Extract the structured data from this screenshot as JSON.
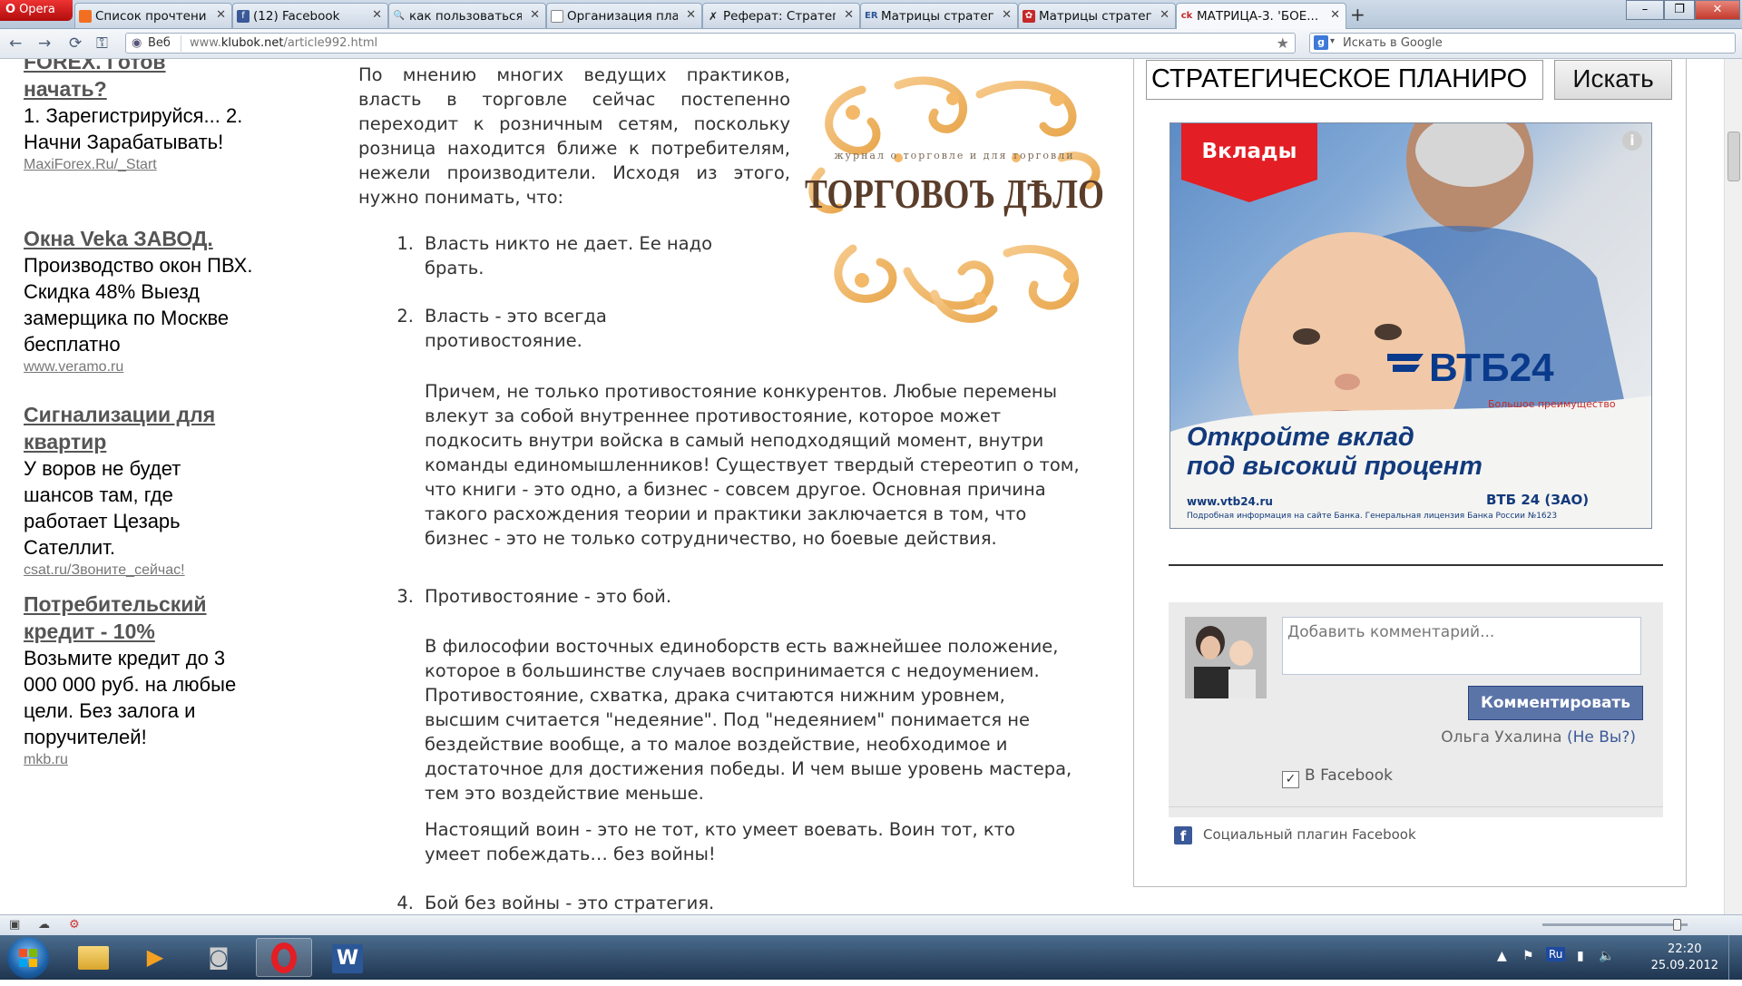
{
  "browser": {
    "menu_label": "Opera",
    "tabs": [
      {
        "label": "Список прочтени...",
        "favicon_color": "#f26f21"
      },
      {
        "label": "(12) Facebook",
        "favicon_color": "#3b5998"
      },
      {
        "label": "как пользоваться...",
        "favicon_color": "#444444"
      },
      {
        "label": "Организация пла...",
        "favicon_color": "#888888"
      },
      {
        "label": "Реферат: Стратег...",
        "favicon_color": "#222222"
      },
      {
        "label": "Матрицы стратег...",
        "favicon_color": "#2b5797"
      },
      {
        "label": "Матрицы стратег...",
        "favicon_color": "#c62828"
      },
      {
        "label": "МАТРИЦА-3. 'БОЕ...",
        "favicon_color": "#c62828"
      }
    ],
    "active_tab_index": 7,
    "address": {
      "mode_label": "Веб",
      "url_prefix": "www.",
      "url_domain": "klubok.net",
      "url_path": "/article992.html"
    },
    "search_placeholder": "Искать в Google"
  },
  "ads": [
    {
      "title": "FOREX. Готов начать?",
      "text": "1. Зарегистрируйся... 2. Начни Зарабатывать!",
      "link": "MaxiForex.Ru/_Start"
    },
    {
      "title": "Окна Veka ЗАВОД.",
      "text": "Производство окон ПВХ. Скидка 48% Выезд замерщика по Москве бесплатно",
      "link": "www.veramo.ru"
    },
    {
      "title": "Сигнализации для квартир",
      "text": "У воров не будет шансов там, где работает Цезарь Сателлит.",
      "link": "csat.ru/Звоните_сейчас!"
    },
    {
      "title": "Потребительский кредит - 10%",
      "text": "Возьмите кредит до 3 000 000 руб. на любые цели. Без залога и поручителей!",
      "link": "mkb.ru"
    }
  ],
  "article": {
    "intro": "По мнению многих ведущих практиков, власть в торговле сейчас постепенно переходит к розничным сетям, поскольку розница находится ближе к потребителям, нежели производители. Исходя из этого, нужно понимать, что:",
    "items": [
      {
        "num": "1.",
        "text": "Власть никто не дает. Ее надо брать."
      },
      {
        "num": "2.",
        "text": "Власть - это всегда противостояние."
      },
      {
        "num": "3.",
        "text": "Противостояние - это бой."
      },
      {
        "num": "4.",
        "text": "Бой без войны - это стратегия."
      }
    ],
    "para_2": [
      "Причем, не только противостояние конкурентов. Любые перемены",
      "влекут за собой внутреннее противостояние, которое может",
      "подкосить внутри войска в самый неподходящий момент, внутри",
      "команды единомышленников! Существует твердый стереотип о том,",
      "что книги - это одно, а бизнес - совсем другое. Основная причина",
      "такого расхождения теории и практики заключается в том, что",
      "бизнес - это не только сотрудничество, но боевые действия."
    ],
    "para_3a": [
      "В философии восточных единоборств есть важнейшее положение,",
      "которое в большинстве случаев воспринимается с недоумением.",
      "Противостояние, схватка, драка считаются нижним уровнем,",
      "высшим считается \"недеяние\". Под \"недеянием\" понимается не",
      "бездействие вообще, а то малое воздействие, необходимое и",
      "достаточное для достижения победы. И чем выше уровень мастера,",
      "тем это воздействие меньше."
    ],
    "para_3b": [
      "Настоящий воин - это не тот, кто умеет воевать. Воин тот, кто",
      "умеет побеждать… без войны!"
    ],
    "logo": {
      "tagline": "журнал о торговле и для торговли",
      "name": "ТОРГОВОЪ ДѢЛО"
    }
  },
  "sidebar": {
    "search_value": "СТРАТЕГИЧЕСКОЕ ПЛАНИРО",
    "search_button": "Искать",
    "banner": {
      "badge": "Вклады",
      "brand": "ВТБ24",
      "brand_sub": "Большое преимущество",
      "headline_1": "Откройте вклад",
      "headline_2": "под высокий процент",
      "site": "www.vtb24.ru",
      "entity": "ВТБ 24 (ЗАО)",
      "fineprint": "Подробная информация на сайте Банка. Генеральная лицензия Банка России №1623",
      "badge_color": "#e31e24",
      "brand_color": "#0a3a8c"
    },
    "comments": {
      "placeholder": "Добавить комментарий...",
      "submit": "Комментировать",
      "user": "Ольга Ухалина",
      "not_you": "(Не Вы?)",
      "post_to": "В Facebook",
      "post_to_checked": true,
      "plugin_label": "Социальный плагин Facebook"
    }
  },
  "taskbar": {
    "lang": "Ru",
    "time": "22:20",
    "date": "25.09.2012"
  }
}
